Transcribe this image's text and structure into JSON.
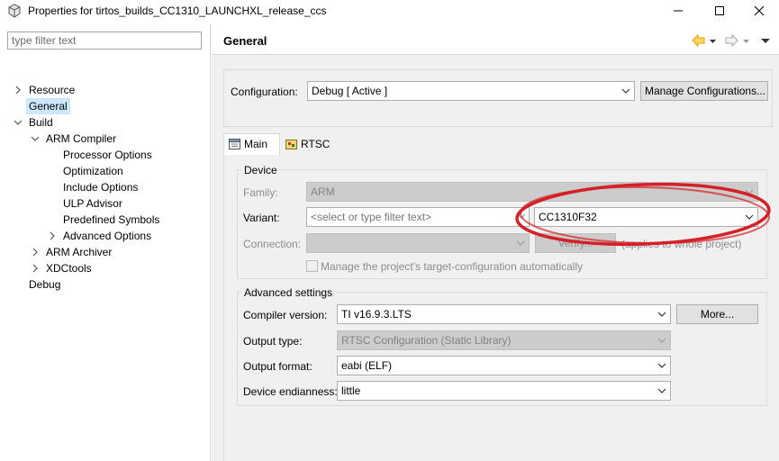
{
  "window": {
    "title": "Properties for tirtos_builds_CC1310_LAUNCHXL_release_ccs"
  },
  "filter": {
    "placeholder": "type filter text"
  },
  "tree": {
    "resource": "Resource",
    "general": "General",
    "build": "Build",
    "arm_compiler": "ARM Compiler",
    "processor_options": "Processor Options",
    "optimization": "Optimization",
    "include_options": "Include Options",
    "ulp_advisor": "ULP Advisor",
    "predefined_symbols": "Predefined Symbols",
    "advanced_options": "Advanced Options",
    "arm_archiver": "ARM Archiver",
    "xdctools": "XDCtools",
    "debug": "Debug"
  },
  "page": {
    "title": "General"
  },
  "configuration": {
    "label": "Configuration:",
    "value": "Debug  [ Active ]",
    "manage_button": "Manage Configurations..."
  },
  "tabs": {
    "main": "Main",
    "rtsc": "RTSC"
  },
  "device": {
    "group_title": "Device",
    "family_label": "Family:",
    "family_value": "ARM",
    "variant_label": "Variant:",
    "variant_filter_placeholder": "<select or type filter text>",
    "variant_value": "CC1310F32",
    "connection_label": "Connection:",
    "verify_button": "Verify...",
    "applies_note": "(applies to whole project)",
    "manage_target_label": "Manage the project's target-configuration automatically"
  },
  "advanced": {
    "group_title": "Advanced settings",
    "compiler_version_label": "Compiler version:",
    "compiler_version_value": "TI v16.9.3.LTS",
    "more_button": "More...",
    "output_type_label": "Output type:",
    "output_type_value": "RTSC Configuration (Static Library)",
    "output_format_label": "Output format:",
    "output_format_value": "eabi (ELF)",
    "endianness_label": "Device endianness:",
    "endianness_value": "little"
  },
  "colors": {
    "selection": "#cce8ff",
    "annotation_ellipse": "#d42027",
    "back_arrow": "#e8a000"
  }
}
